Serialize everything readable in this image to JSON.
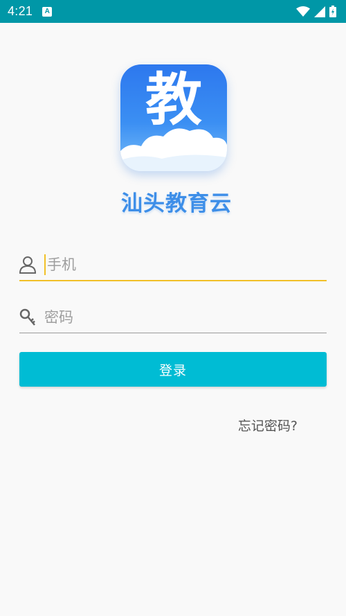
{
  "status_bar": {
    "time": "4:21",
    "notification_icon": "A",
    "icons": [
      "wifi-icon",
      "signal-icon",
      "battery-icon"
    ]
  },
  "logo": {
    "character": "教",
    "app_name": "汕头教育云"
  },
  "form": {
    "phone_placeholder": "手机",
    "password_placeholder": "密码",
    "login_label": "登录",
    "forgot_label": "忘记密码?"
  },
  "colors": {
    "status_bar": "#0097a7",
    "accent_underline": "#f2c027",
    "login_button": "#00bcd4",
    "logo_blue": "#2f7ff0"
  }
}
